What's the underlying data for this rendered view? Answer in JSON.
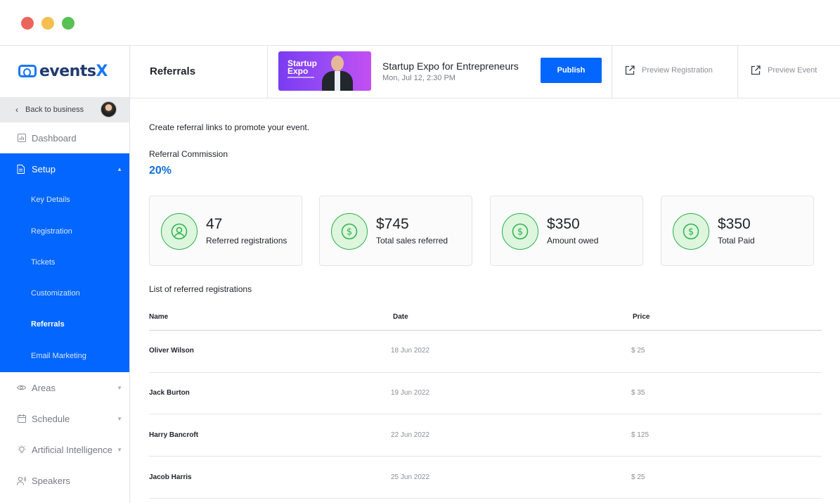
{
  "app": {
    "logo_text_a": "events",
    "logo_text_b": "X"
  },
  "sidebar": {
    "back_label": "Back to business",
    "items": [
      {
        "label": "Dashboard"
      },
      {
        "label": "Setup"
      },
      {
        "label": "Areas"
      },
      {
        "label": "Schedule"
      },
      {
        "label": "Artificial Intelligence"
      },
      {
        "label": "Speakers"
      }
    ],
    "setup_sub": [
      {
        "label": "Key Details"
      },
      {
        "label": "Registration"
      },
      {
        "label": "Tickets"
      },
      {
        "label": "Customization"
      },
      {
        "label": "Referrals"
      },
      {
        "label": "Email Marketing"
      }
    ]
  },
  "header": {
    "title": "Referrals",
    "thumb_text_1": "Startup",
    "thumb_text_2": "Expo",
    "event_name": "Startup Expo for Entrepreneurs",
    "event_date": "Mon, Jul 12, 2:30 PM",
    "publish_label": "Publish",
    "preview_registration": "Preview Registration",
    "preview_event": "Preview Event"
  },
  "main": {
    "intro": "Create referral links to promote your event.",
    "commission_label": "Referral Commission",
    "commission_value": "20%",
    "stats": [
      {
        "value": "47",
        "label": "Referred registrations",
        "icon": "user-icon"
      },
      {
        "value": "$745",
        "label": "Total sales referred",
        "icon": "dollar-icon"
      },
      {
        "value": "$350",
        "label": "Amount owed",
        "icon": "dollar-icon"
      },
      {
        "value": "$350",
        "label": "Total Paid",
        "icon": "dollar-icon"
      }
    ],
    "list_title": "List of referred registrations",
    "columns": {
      "name": "Name",
      "date": "Date",
      "price": "Price"
    },
    "rows": [
      {
        "name": "Oliver Wilson",
        "date": "18 Jun 2022",
        "price": "$ 25"
      },
      {
        "name": "Jack Burton",
        "date": "19 Jun 2022",
        "price": "$ 35"
      },
      {
        "name": "Harry Bancroft",
        "date": "22 Jun 2022",
        "price": "$ 125"
      },
      {
        "name": "Jacob Harris",
        "date": "25 Jun 2022",
        "price": "$ 25"
      }
    ]
  },
  "colors": {
    "accent": "#0366ff",
    "commission": "#0f6fd8",
    "stat_green": "#2bb24c",
    "stat_bg": "#def5de"
  }
}
